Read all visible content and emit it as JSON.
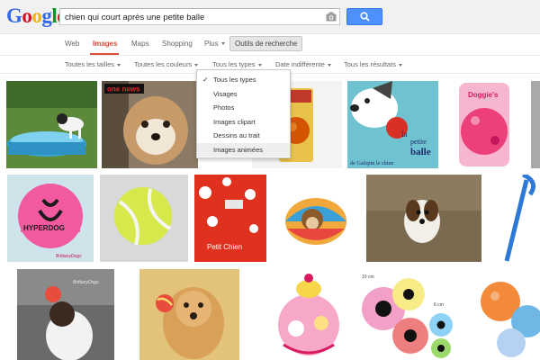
{
  "logo": {
    "letters": [
      "G",
      "o",
      "o",
      "g",
      "l",
      "e"
    ],
    "colors": [
      "#3369e8",
      "#d50f25",
      "#eeb211",
      "#3369e8",
      "#009925",
      "#d50f25"
    ]
  },
  "search": {
    "query": "chien qui court après une petite balle"
  },
  "tabs": {
    "web": "Web",
    "images": "Images",
    "maps": "Maps",
    "shopping": "Shopping",
    "plus": "Plus",
    "tools": "Outils de recherche"
  },
  "filters": {
    "sizes": "Toutes les tailles",
    "colors": "Toutes les couleurs",
    "types": "Tous les types",
    "date": "Date indifférente",
    "results": "Tous les résultats"
  },
  "dropdown": {
    "items": [
      {
        "label": "Tous les types",
        "checked": true
      },
      {
        "label": "Visages"
      },
      {
        "label": "Photos"
      },
      {
        "label": "Images clipart"
      },
      {
        "label": "Dessins au trait"
      },
      {
        "label": "Images animées",
        "hovered": true
      }
    ]
  },
  "images": {
    "news_logo": "one news",
    "book_title": {
      "la": "la",
      "petite": "petite",
      "balle": "balle",
      "subtitle": "de Galopin le chien"
    },
    "doggies_brand": "Doggie's",
    "hyperdog_brand": "HYPERDOG",
    "hyperdog_credit": "BrittanyDogs",
    "petit_chien": "Petit Chien",
    "rank_credit": "BrittanyDogs",
    "size_10cm": "10 cm",
    "size_6cm": "6 cm"
  },
  "colors": {
    "accent_red": "#dd4b39",
    "search_blue": "#4d90fe"
  }
}
